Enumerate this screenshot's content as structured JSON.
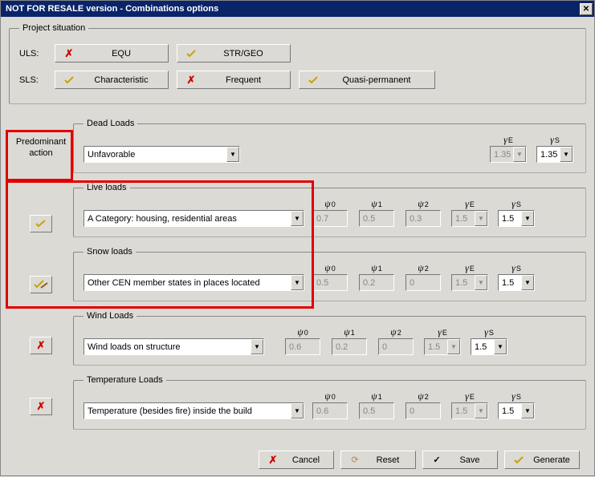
{
  "title": "NOT FOR RESALE version - Combinations options",
  "groups": {
    "project_situation": "Project situation",
    "dead_loads": "Dead Loads",
    "live_loads": "Live loads",
    "snow_loads": "Snow loads",
    "wind_loads": "Wind Loads",
    "temperature_loads": "Temperature Loads"
  },
  "labels": {
    "uls": "ULS:",
    "sls": "SLS:",
    "predominant": "Predominant\naction"
  },
  "uls_options": {
    "equ": "EQU",
    "str_geo": "STR/GEO"
  },
  "sls_options": {
    "characteristic": "Characteristic",
    "frequent": "Frequent",
    "quasi": "Quasi-permanent"
  },
  "dead": {
    "select": "Unfavorable",
    "gE": "1.35",
    "gS": "1.35"
  },
  "live": {
    "select": "A Category: housing, residential areas",
    "psi0": "0.7",
    "psi1": "0.5",
    "psi2": "0.3",
    "gE": "1.5",
    "gS": "1.5"
  },
  "snow": {
    "select": "Other CEN member states in places located",
    "psi0": "0.5",
    "psi1": "0.2",
    "psi2": "0",
    "gE": "1.5",
    "gS": "1.5"
  },
  "wind": {
    "select": "Wind loads on structure",
    "psi0": "0.6",
    "psi1": "0.2",
    "psi2": "0",
    "gE": "1.5",
    "gS": "1.5"
  },
  "temp": {
    "select": "Temperature (besides fire) inside the build",
    "psi0": "0.6",
    "psi1": "0.5",
    "psi2": "0",
    "gE": "1.5",
    "gS": "1.5"
  },
  "param_labels": {
    "psi0": "ψ0",
    "psi1": "ψ1",
    "psi2": "ψ2",
    "gE_pre": "γ",
    "gE_sub": "E",
    "gS_pre": "γ",
    "gS_sub": "S"
  },
  "footer": {
    "cancel": "Cancel",
    "reset": "Reset",
    "save": "Save",
    "generate": "Generate"
  }
}
